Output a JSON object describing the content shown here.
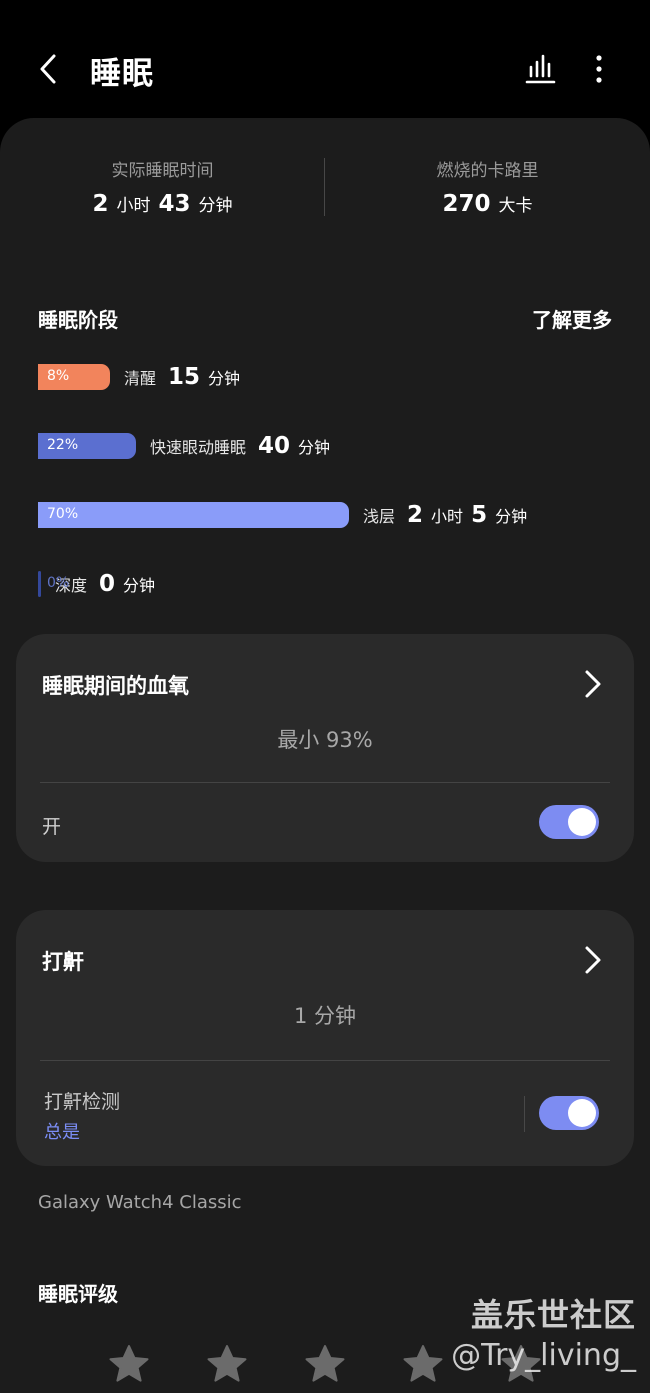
{
  "header": {
    "title": "睡眠"
  },
  "summary": {
    "actual_sleep_label": "实际睡眠时间",
    "actual_sleep_h": "2",
    "actual_sleep_h_unit": "小时",
    "actual_sleep_m": "43",
    "actual_sleep_m_unit": "分钟",
    "calories_label": "燃烧的卡路里",
    "calories_value": "270",
    "calories_unit": "大卡"
  },
  "stages": {
    "title": "睡眠阶段",
    "learn_more": "了解更多",
    "items": [
      {
        "pct_label": "8%",
        "percent": 8,
        "color": "#f2845c",
        "label": "清醒",
        "minutes": "15",
        "minutes_unit": "分钟"
      },
      {
        "pct_label": "22%",
        "percent": 22,
        "color": "#5b6fd0",
        "label": "快速眼动睡眠",
        "minutes": "40",
        "minutes_unit": "分钟"
      },
      {
        "pct_label": "70%",
        "percent": 70,
        "color": "#8a9cf9",
        "label": "浅层",
        "hours": "2",
        "hours_unit": "小时",
        "minutes": "5",
        "minutes_unit": "分钟"
      },
      {
        "pct_label": "0%",
        "percent": 0,
        "color": "#34489b",
        "label": "深度",
        "minutes": "0",
        "minutes_unit": "分钟"
      }
    ]
  },
  "oxygen_card": {
    "title": "睡眠期间的血氧",
    "value": "最小 93%",
    "toggle_label": "开",
    "toggle_on": true
  },
  "snore_card": {
    "title": "打鼾",
    "value": "1 分钟",
    "detect_label": "打鼾检测",
    "detect_sub": "总是",
    "toggle_on": true
  },
  "device_name": "Galaxy Watch4 Classic",
  "rating": {
    "title": "睡眠评级",
    "stars_filled": 0,
    "stars_total": 5
  },
  "watermark": {
    "line1": "盖乐世社区",
    "line2": "@Try_living_"
  },
  "colors": {
    "accent": "#7d8cf2",
    "card_bg": "#2a2a2a",
    "page_bg": "#1c1c1c"
  }
}
